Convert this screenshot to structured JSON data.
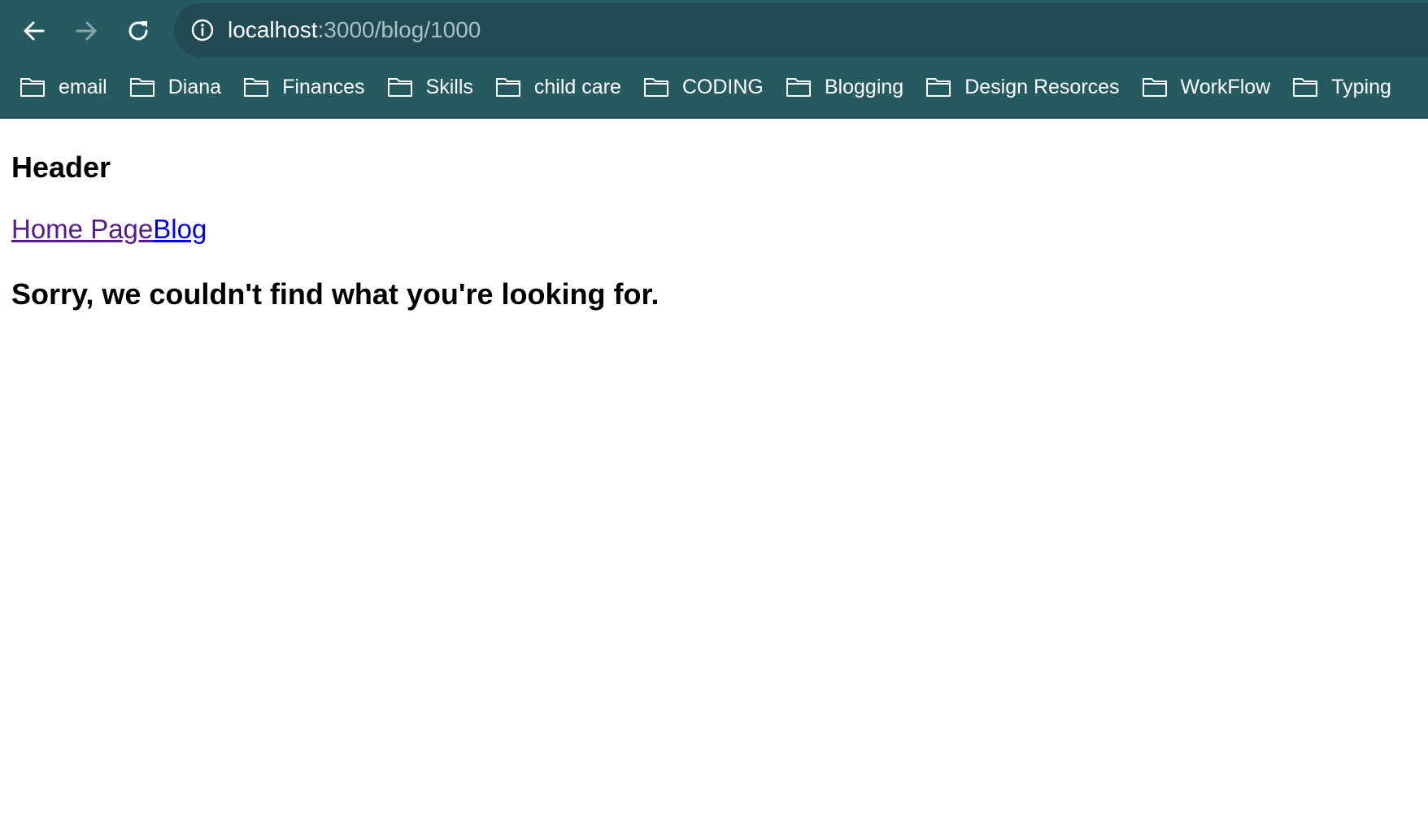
{
  "browser": {
    "url_host": "localhost",
    "url_path": ":3000/blog/1000",
    "bookmarks": [
      {
        "label": "email"
      },
      {
        "label": "Diana"
      },
      {
        "label": "Finances"
      },
      {
        "label": "Skills"
      },
      {
        "label": "child care"
      },
      {
        "label": "CODING"
      },
      {
        "label": "Blogging"
      },
      {
        "label": "Design Resorces"
      },
      {
        "label": "WorkFlow"
      },
      {
        "label": "Typing"
      }
    ]
  },
  "page": {
    "header": "Header",
    "links": [
      {
        "label": "Home Page"
      },
      {
        "label": "Blog"
      }
    ],
    "message": "Sorry, we couldn't find what you're looking for."
  },
  "colors": {
    "chrome_bg": "#255a61",
    "omnibox_bg": "#214a52",
    "link": "#0000ee",
    "visited_link": "#551a8b"
  }
}
